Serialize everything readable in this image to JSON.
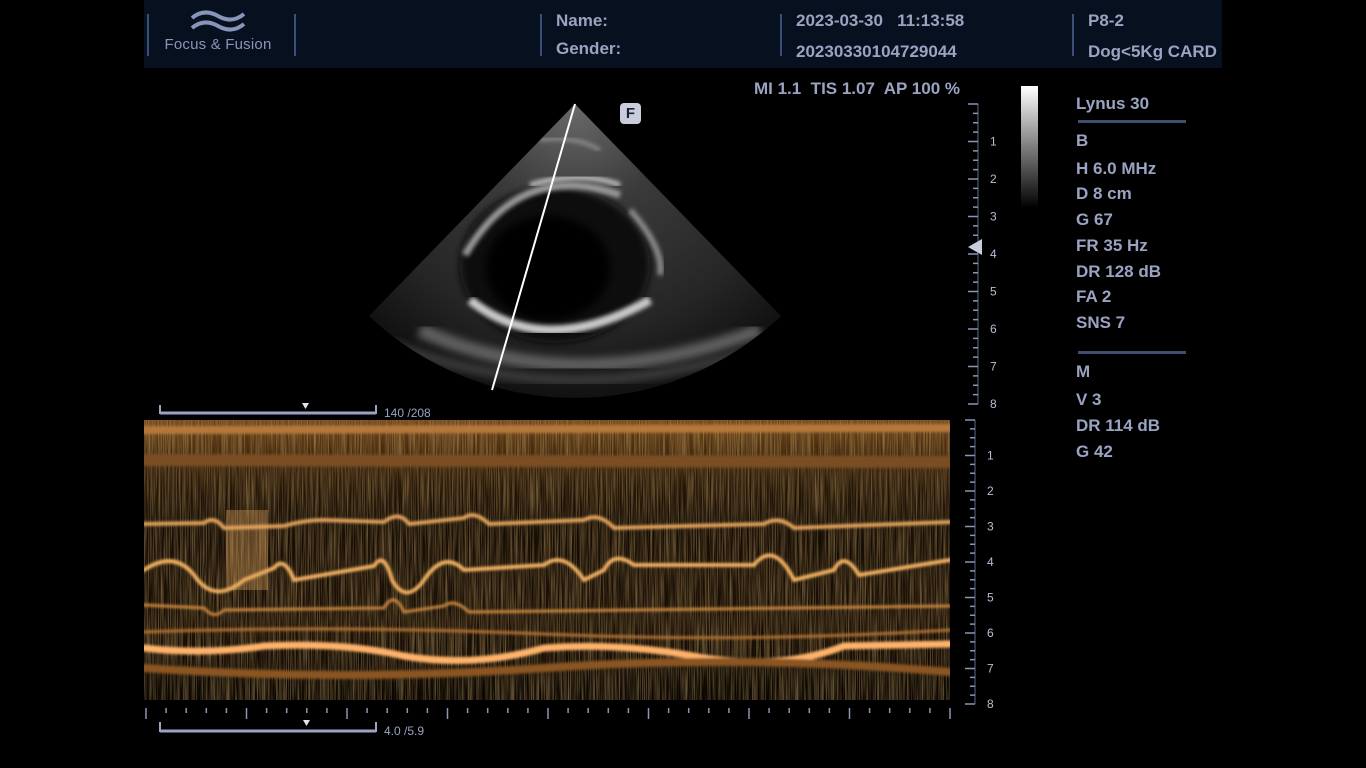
{
  "header": {
    "logo_text": "Focus & Fusion",
    "name_label": "Name:",
    "gender_label": "Gender:",
    "date_time": "2023-03-30   11:13:58",
    "exam_id": "20230330104729044",
    "probe": "P8-2",
    "preset": "Dog<5Kg CARD"
  },
  "safety": {
    "text": "MI 1.1  TIS 1.07  AP 100 %"
  },
  "focus_badge": "F",
  "panel": {
    "device": "Lynus 30",
    "b_mode": {
      "title": "B",
      "freq": "H 6.0 MHz",
      "depth": "D 8 cm",
      "gain": "G 67",
      "frame_rate": "FR 35 Hz",
      "dynamic_range": "DR 128 dB",
      "fa": "FA 2",
      "sns": "SNS 7"
    },
    "m_mode": {
      "title": "M",
      "v": "V 3",
      "dynamic_range": "DR 114 dB",
      "gain": "G 42"
    }
  },
  "depth_scale_b": [
    "1",
    "2",
    "3",
    "4",
    "5",
    "6",
    "7",
    "8"
  ],
  "depth_scale_m": [
    "1",
    "2",
    "3",
    "4",
    "5",
    "6",
    "7",
    "8"
  ],
  "b_frame_counter": "140 /208",
  "m_time_counter": "4.0 /5.9",
  "colors": {
    "header_bg": "#07101e",
    "accent": "#3b4e78",
    "text": "#9aa3c1",
    "mmode_tint": "#d98a2e"
  }
}
